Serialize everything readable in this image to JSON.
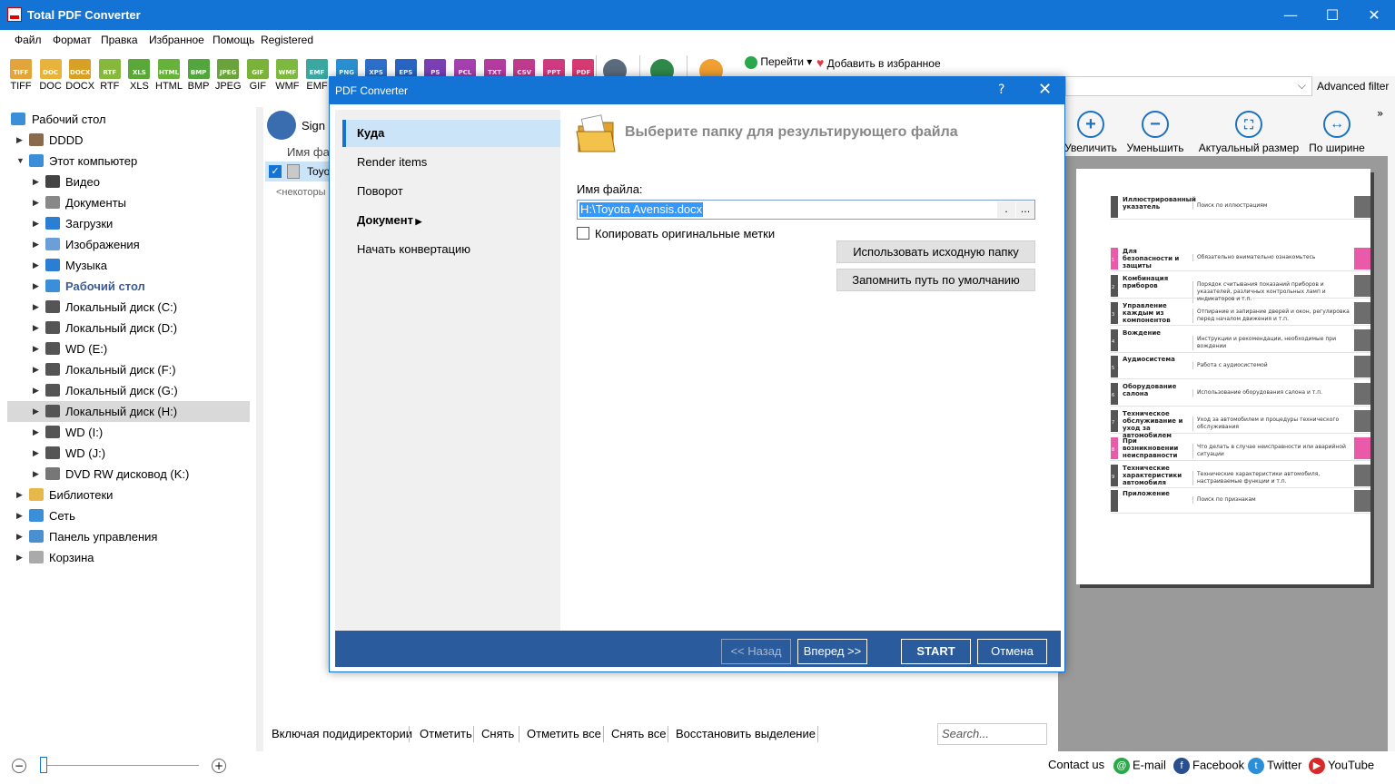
{
  "window": {
    "title": "Total PDF Converter"
  },
  "menu": [
    "Файл",
    "Формат",
    "Правка",
    "Избранное",
    "Помощь",
    "Registered"
  ],
  "formats": [
    {
      "label": "TIFF",
      "color": "#e3a43b"
    },
    {
      "label": "DOC",
      "color": "#e8b33a"
    },
    {
      "label": "DOCX",
      "color": "#d9a026"
    },
    {
      "label": "RTF",
      "color": "#86b83b"
    },
    {
      "label": "XLS",
      "color": "#5aa73a"
    },
    {
      "label": "HTML",
      "color": "#66b23a"
    },
    {
      "label": "BMP",
      "color": "#53a53d"
    },
    {
      "label": "JPEG",
      "color": "#6aa33b"
    },
    {
      "label": "GIF",
      "color": "#7bb33a"
    },
    {
      "label": "WMF",
      "color": "#7db93e"
    },
    {
      "label": "EMF",
      "color": "#3aa8a0"
    }
  ],
  "formats_extra": [
    {
      "label": "PNG",
      "color": "#2a8fd0"
    },
    {
      "label": "XPS",
      "color": "#2b6fc9"
    },
    {
      "label": "EPS",
      "color": "#2a64c2"
    },
    {
      "label": "PS",
      "color": "#7a3fb5"
    },
    {
      "label": "PCL",
      "color": "#a63fb0"
    },
    {
      "label": "TXT",
      "color": "#b53aa0"
    },
    {
      "label": "CSV",
      "color": "#c03a8e"
    },
    {
      "label": "PPT",
      "color": "#cf3a80"
    },
    {
      "label": "PDF",
      "color": "#d63a72"
    }
  ],
  "toolbar": {
    "goto": "Перейти",
    "add_fav": "Добавить в избранное",
    "advanced_filter": "Advanced filter",
    "sign": "Sign",
    "file_col": "Имя фа",
    "file_row": "Toyo",
    "placeholder_row": "<некоторы"
  },
  "tree": [
    {
      "label": "Рабочий стол",
      "level": 0,
      "arrow": "",
      "icon": "#3a8fd8"
    },
    {
      "label": "DDDD",
      "level": 1,
      "arrow": "▶",
      "icon": "#8a6a4a"
    },
    {
      "label": "Этот компьютер",
      "level": 1,
      "arrow": "▼",
      "icon": "#3a8fd8"
    },
    {
      "label": "Видео",
      "level": 2,
      "arrow": "▶",
      "icon": "#444"
    },
    {
      "label": "Документы",
      "level": 2,
      "arrow": "▶",
      "icon": "#888"
    },
    {
      "label": "Загрузки",
      "level": 2,
      "arrow": "▶",
      "icon": "#2a7fd5"
    },
    {
      "label": "Изображения",
      "level": 2,
      "arrow": "▶",
      "icon": "#6a9fd8"
    },
    {
      "label": "Музыка",
      "level": 2,
      "arrow": "▶",
      "icon": "#2a7fd5"
    },
    {
      "label": "Рабочий стол",
      "level": 2,
      "arrow": "▶",
      "icon": "#3a8fd8",
      "bold": true
    },
    {
      "label": "Локальный диск (C:)",
      "level": 2,
      "arrow": "▶",
      "icon": "#555"
    },
    {
      "label": "Локальный диск (D:)",
      "level": 2,
      "arrow": "▶",
      "icon": "#555"
    },
    {
      "label": "WD (E:)",
      "level": 2,
      "arrow": "▶",
      "icon": "#555"
    },
    {
      "label": "Локальный диск (F:)",
      "level": 2,
      "arrow": "▶",
      "icon": "#555"
    },
    {
      "label": "Локальный диск (G:)",
      "level": 2,
      "arrow": "▶",
      "icon": "#555"
    },
    {
      "label": "Локальный диск (H:)",
      "level": 2,
      "arrow": "▶",
      "icon": "#555",
      "selected": true
    },
    {
      "label": "WD (I:)",
      "level": 2,
      "arrow": "▶",
      "icon": "#555"
    },
    {
      "label": "WD (J:)",
      "level": 2,
      "arrow": "▶",
      "icon": "#555"
    },
    {
      "label": "DVD RW дисковод (K:)",
      "level": 2,
      "arrow": "▶",
      "icon": "#777"
    },
    {
      "label": "Библиотеки",
      "level": 1,
      "arrow": "▶",
      "icon": "#e6b84a"
    },
    {
      "label": "Сеть",
      "level": 1,
      "arrow": "▶",
      "icon": "#3a8fd8"
    },
    {
      "label": "Панель управления",
      "level": 1,
      "arrow": "▶",
      "icon": "#4a8fd0"
    },
    {
      "label": "Корзина",
      "level": 1,
      "arrow": "▶",
      "icon": "#aaa"
    }
  ],
  "bottom_links": [
    "Включая подидиректории",
    "Отметить",
    "Снять",
    "Отметить все",
    "Снять все",
    "Восстановить выделение"
  ],
  "search_placeholder": "Search...",
  "right_tools": [
    "Увеличить",
    "Уменьшить",
    "Актуальный размер",
    "По ширине"
  ],
  "preview_rows": [
    {
      "num": "",
      "title": "Иллюстрированный указатель",
      "desc": "Поиск по иллюстрациям",
      "pink": false
    },
    {
      "num": "1",
      "title": "Для безопасности и защиты",
      "desc": "Обязательно внимательно ознакомьтесь",
      "pink": true
    },
    {
      "num": "2",
      "title": "Комбинация приборов",
      "desc": "Порядок считывания показаний приборов и указателей, различных контрольных ламп и индикаторов и т.п.",
      "pink": false
    },
    {
      "num": "3",
      "title": "Управление каждым из компонентов",
      "desc": "Отпирание и запирание дверей и окон, регулировка перед началом движения и т.п.",
      "pink": false
    },
    {
      "num": "4",
      "title": "Вождение",
      "desc": "Инструкции и рекомендации, необходимые при вождении",
      "pink": false
    },
    {
      "num": "5",
      "title": "Аудиосистема",
      "desc": "Работа с аудиосистемой",
      "pink": false
    },
    {
      "num": "6",
      "title": "Оборудование салона",
      "desc": "Использование оборудования салона и т.п.",
      "pink": false
    },
    {
      "num": "7",
      "title": "Техническое обслуживание и уход за автомобилем",
      "desc": "Уход за автомобилем и процедуры технического обслуживания",
      "pink": false
    },
    {
      "num": "8",
      "title": "При возникновении неисправности",
      "desc": "Что делать в случае неисправности или аварийной ситуации",
      "pink": true
    },
    {
      "num": "9",
      "title": "Технические характеристики автомобиля",
      "desc": "Технические характеристики автомобиля, настраиваемые функции и т.п.",
      "pink": false
    },
    {
      "num": "",
      "title": "Приложение",
      "desc": "Поиск по признакам",
      "pink": false
    }
  ],
  "status": {
    "contact": "Contact us",
    "email": "E-mail",
    "facebook": "Facebook",
    "twitter": "Twitter",
    "youtube": "YouTube"
  },
  "dialog": {
    "title": "PDF Converter",
    "nav": [
      {
        "label": "Куда",
        "active": true
      },
      {
        "label": "Render items"
      },
      {
        "label": "Поворот"
      },
      {
        "label": "Документ",
        "bold": true,
        "arrow": true
      },
      {
        "label": "Начать конвертацию"
      }
    ],
    "heading": "Выберите папку для результирующего файла",
    "filename_label": "Имя файла:",
    "filename_value": "H:\\Toyota Avensis.docx",
    "copy_tags_label": "Копировать оригинальные метки",
    "use_source_btn": "Использовать исходную папку",
    "remember_btn": "Запомнить путь по умолчанию",
    "back_btn": "<< Назад",
    "next_btn": "Вперед >>",
    "start_btn": "START",
    "cancel_btn": "Отмена"
  }
}
